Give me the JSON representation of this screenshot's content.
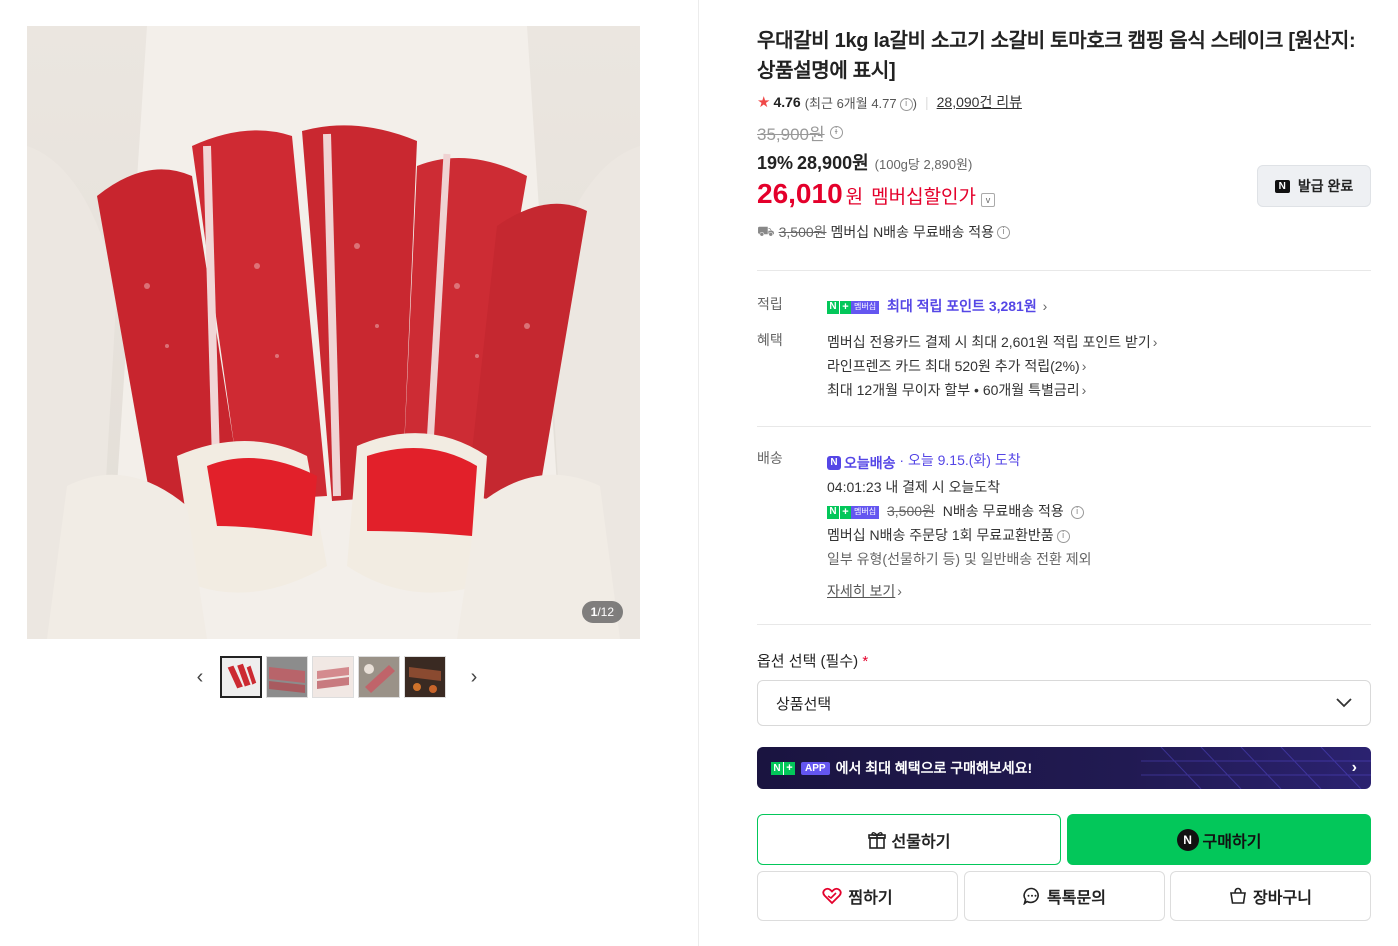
{
  "gallery": {
    "counter_current": "1",
    "counter_total": "/12",
    "prev_arrow": "‹",
    "next_arrow": "›"
  },
  "product": {
    "title": "우대갈비 1kg la갈비 소고기 소갈비 토마호크 캠핑 음식 스테이크 [원산지:상품설명에 표시]",
    "rating": "4.76",
    "recent_rating": "(최근 6개월 4.77",
    "recent_close": ")",
    "review_count": "28,090건 리뷰",
    "original_price": "35,900원",
    "discount_pct": "19%",
    "sale_price": "28,900원",
    "per_100g": "(100g당 2,890원)",
    "member_price": "26,010",
    "member_price_unit": "원",
    "member_label": "멤버십할인가",
    "coupon_button": "발급 완료",
    "shipping_strike": "3,500원",
    "shipping_text": "멤버십 N배송 무료배송 적용"
  },
  "points": {
    "label": "적립",
    "text": "최대 적립 포인트 3,281원"
  },
  "benefits": {
    "label": "혜택",
    "items": [
      "멤버십 전용카드 결제 시 최대 2,601원 적립 포인트 받기",
      "라인프렌즈 카드 최대 520원 추가 적립(2%)",
      "최대 12개월 무이자 할부 • 60개월 특별금리"
    ]
  },
  "delivery": {
    "label": "배송",
    "badge": "오늘배송",
    "arrival": "· 오늘 9.15.(화) 도착",
    "cutoff": "04:01:23  내 결제 시 오늘도착",
    "strike": "3,500원",
    "free_text": "N배송 무료배송 적용",
    "exchange": "멤버십 N배송 주문당 1회 무료교환반품",
    "exclude": "일부 유형(선물하기 등) 및 일반배송 전환 제외",
    "more": "자세히 보기"
  },
  "badges": {
    "n": "N",
    "plus": "+",
    "membership": "멤버십",
    "app": "APP"
  },
  "option": {
    "label": "옵션 선택 (필수)",
    "required_mark": "*",
    "select_value": "상품선택"
  },
  "banner": {
    "text": "에서 최대 혜택으로 구매해보세요!"
  },
  "buttons": {
    "gift": "선물하기",
    "buy": "구매하기",
    "wish": "찜하기",
    "talk": "톡톡문의",
    "cart": "장바구니"
  },
  "colors": {
    "naver_green": "#03c75a",
    "member_red": "#e4002b",
    "purple": "#5546e6"
  }
}
